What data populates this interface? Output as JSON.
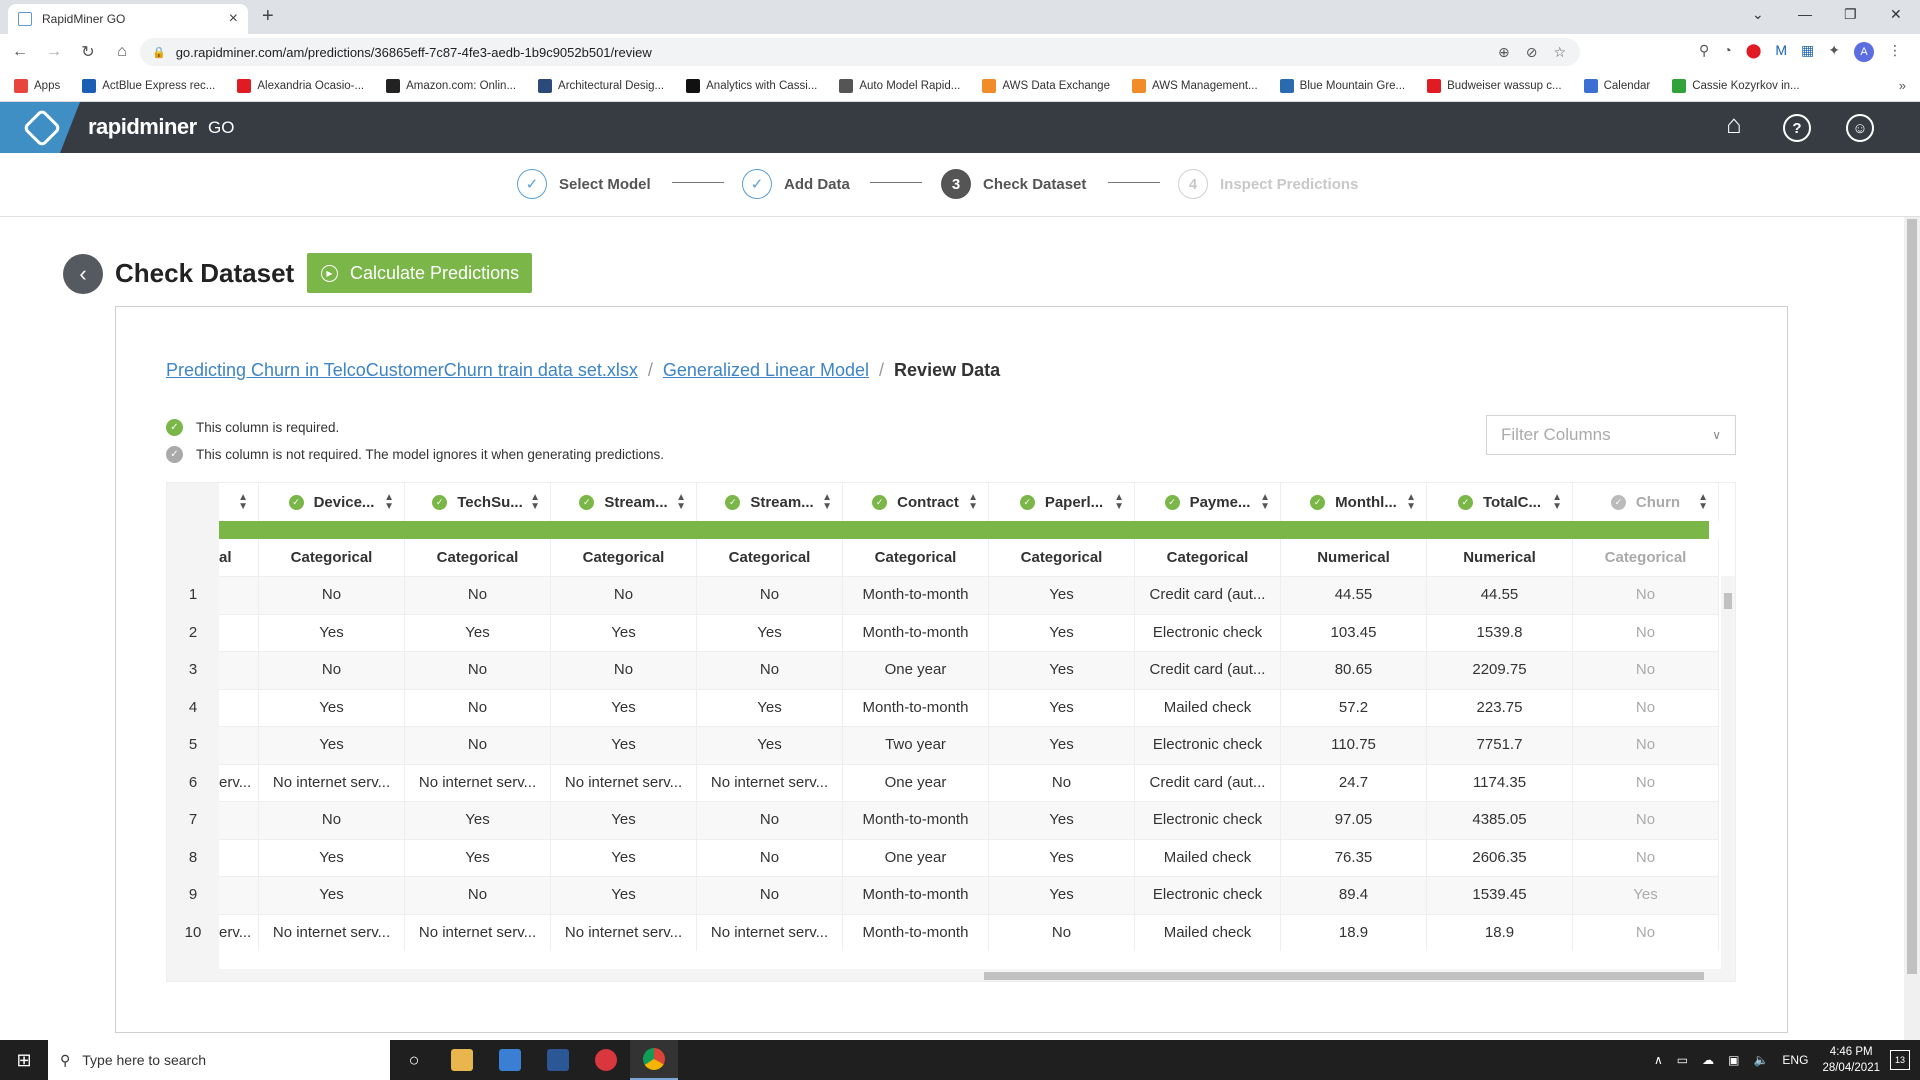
{
  "browser": {
    "tab_title": "RapidMiner GO",
    "url": "go.rapidminer.com/am/predictions/36865eff-7c87-4fe3-aedb-1b9c9052b501/review",
    "avatar_letter": "A",
    "bookmarks": [
      {
        "label": "Apps",
        "color": "#e8453c"
      },
      {
        "label": "ActBlue Express rec...",
        "color": "#1a5fb4"
      },
      {
        "label": "Alexandria Ocasio-...",
        "color": "#e01b24"
      },
      {
        "label": "Amazon.com: Onlin...",
        "color": "#222222"
      },
      {
        "label": "Architectural Desig...",
        "color": "#2b4a7a"
      },
      {
        "label": "Analytics with Cassi...",
        "color": "#111111"
      },
      {
        "label": "Auto Model Rapid...",
        "color": "#555555"
      },
      {
        "label": "AWS Data Exchange",
        "color": "#f28c28"
      },
      {
        "label": "AWS Management...",
        "color": "#f28c28"
      },
      {
        "label": "Blue Mountain Gre...",
        "color": "#2a6bb0"
      },
      {
        "label": "Budweiser wassup c...",
        "color": "#e01b24"
      },
      {
        "label": "Calendar",
        "color": "#3b6fd4"
      },
      {
        "label": "Cassie Kozyrkov in...",
        "color": "#2fa33a"
      }
    ]
  },
  "app": {
    "brand": "rapidminer",
    "brand_suffix": "GO"
  },
  "stepper": {
    "steps": [
      {
        "label": "Select Model",
        "marker": "✓"
      },
      {
        "label": "Add Data",
        "marker": "✓"
      },
      {
        "label": "Check Dataset",
        "marker": "3"
      },
      {
        "label": "Inspect Predictions",
        "marker": "4"
      }
    ]
  },
  "page": {
    "title": "Check Dataset",
    "calc_button": "Calculate Predictions",
    "breadcrumb": {
      "link1": "Predicting Churn in TelcoCustomerChurn train data set.xlsx",
      "link2": "Generalized Linear Model",
      "current": "Review Data",
      "sep": "/"
    },
    "legend_required": "This column is required.",
    "legend_not_required": "This column is not required. The model ignores it when generating predictions.",
    "filter_placeholder": "Filter Columns"
  },
  "table": {
    "columns": [
      {
        "name": "",
        "type": "al",
        "required": true,
        "partial": true
      },
      {
        "name": "Device...",
        "type": "Categorical",
        "required": true
      },
      {
        "name": "TechSu...",
        "type": "Categorical",
        "required": true
      },
      {
        "name": "Stream...",
        "type": "Categorical",
        "required": true
      },
      {
        "name": "Stream...",
        "type": "Categorical",
        "required": true
      },
      {
        "name": "Contract",
        "type": "Categorical",
        "required": true
      },
      {
        "name": "Paperl...",
        "type": "Categorical",
        "required": true
      },
      {
        "name": "Payme...",
        "type": "Categorical",
        "required": true
      },
      {
        "name": "Monthl...",
        "type": "Numerical",
        "required": true
      },
      {
        "name": "TotalC...",
        "type": "Numerical",
        "required": true
      },
      {
        "name": "Churn",
        "type": "Categorical",
        "required": false
      }
    ],
    "rows": [
      {
        "n": "1",
        "cells": [
          "",
          "No",
          "No",
          "No",
          "No",
          "Month-to-month",
          "Yes",
          "Credit card (aut...",
          "44.55",
          "44.55",
          "No"
        ]
      },
      {
        "n": "2",
        "cells": [
          "",
          "Yes",
          "Yes",
          "Yes",
          "Yes",
          "Month-to-month",
          "Yes",
          "Electronic check",
          "103.45",
          "1539.8",
          "No"
        ]
      },
      {
        "n": "3",
        "cells": [
          "",
          "No",
          "No",
          "No",
          "No",
          "One year",
          "Yes",
          "Credit card (aut...",
          "80.65",
          "2209.75",
          "No"
        ]
      },
      {
        "n": "4",
        "cells": [
          "",
          "Yes",
          "No",
          "Yes",
          "Yes",
          "Month-to-month",
          "Yes",
          "Mailed check",
          "57.2",
          "223.75",
          "No"
        ]
      },
      {
        "n": "5",
        "cells": [
          "",
          "Yes",
          "No",
          "Yes",
          "Yes",
          "Two year",
          "Yes",
          "Electronic check",
          "110.75",
          "7751.7",
          "No"
        ]
      },
      {
        "n": "6",
        "cells": [
          "erv...",
          "No internet serv...",
          "No internet serv...",
          "No internet serv...",
          "No internet serv...",
          "One year",
          "No",
          "Credit card (aut...",
          "24.7",
          "1174.35",
          "No"
        ]
      },
      {
        "n": "7",
        "cells": [
          "",
          "No",
          "Yes",
          "Yes",
          "No",
          "Month-to-month",
          "Yes",
          "Electronic check",
          "97.05",
          "4385.05",
          "No"
        ]
      },
      {
        "n": "8",
        "cells": [
          "",
          "Yes",
          "Yes",
          "Yes",
          "No",
          "One year",
          "Yes",
          "Mailed check",
          "76.35",
          "2606.35",
          "No"
        ]
      },
      {
        "n": "9",
        "cells": [
          "",
          "Yes",
          "No",
          "Yes",
          "No",
          "Month-to-month",
          "Yes",
          "Electronic check",
          "89.4",
          "1539.45",
          "Yes"
        ]
      },
      {
        "n": "10",
        "cells": [
          "erv...",
          "No internet serv...",
          "No internet serv...",
          "No internet serv...",
          "No internet serv...",
          "Month-to-month",
          "No",
          "Mailed check",
          "18.9",
          "18.9",
          "No"
        ]
      }
    ]
  },
  "taskbar": {
    "search_placeholder": "Type here to search",
    "lang": "ENG",
    "time": "4:46 PM",
    "date": "28/04/2021",
    "notif_count": "13"
  },
  "colors": {
    "accent_green": "#7ab648",
    "app_header": "#373c43",
    "logo_blue": "#3f8fc4",
    "link_blue": "#3d85c6"
  }
}
